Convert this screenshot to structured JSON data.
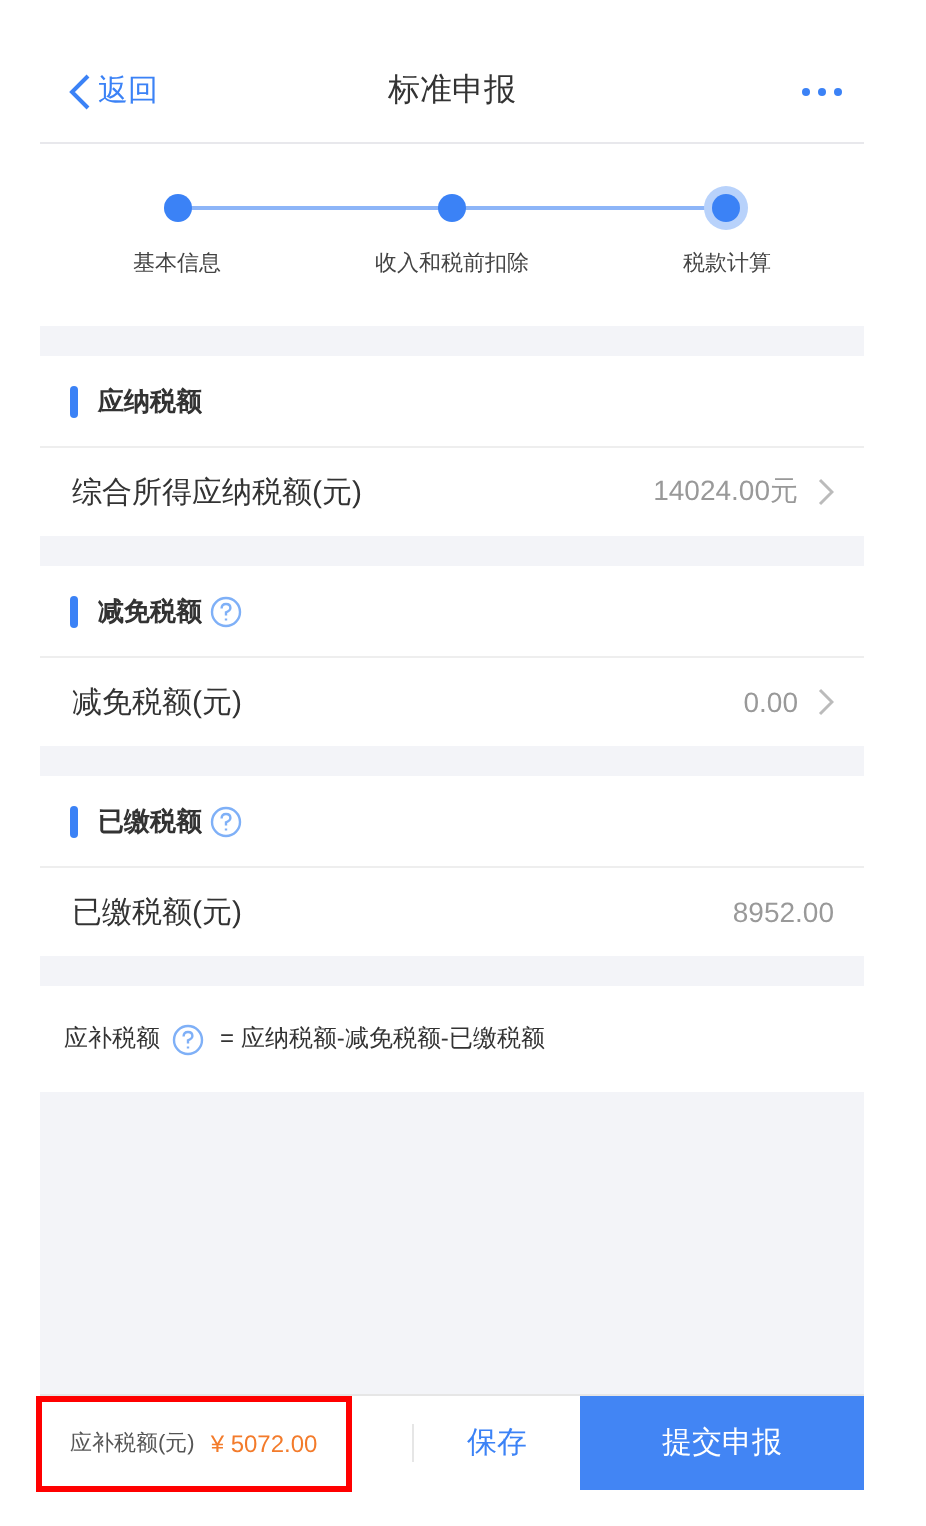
{
  "header": {
    "back": "返回",
    "title": "标准申报"
  },
  "steps": [
    {
      "label": "基本信息",
      "selected": false
    },
    {
      "label": "收入和税前扣除",
      "selected": false
    },
    {
      "label": "税款计算",
      "selected": true
    }
  ],
  "sections": [
    {
      "title": "应纳税额",
      "help": false,
      "row": {
        "label": "综合所得应纳税额(元)",
        "value": "14024.00元",
        "chevron": true
      }
    },
    {
      "title": "减免税额",
      "help": true,
      "row": {
        "label": "减免税额(元)",
        "value": "0.00",
        "chevron": true
      }
    },
    {
      "title": "已缴税额",
      "help": true,
      "row": {
        "label": "已缴税额(元)",
        "value": "8952.00",
        "chevron": false
      }
    }
  ],
  "formula": {
    "label": "应补税额",
    "text": "= 应纳税额-减免税额-已缴税额"
  },
  "footer": {
    "label": "应补税额(元)",
    "amount": "¥ 5072.00",
    "highlighted": true,
    "save": "保存",
    "submit": "提交申报"
  }
}
